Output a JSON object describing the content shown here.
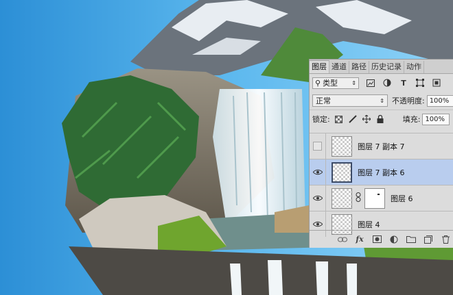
{
  "layers_panel": {
    "tabs": [
      {
        "label": "图层",
        "active": true
      },
      {
        "label": "通道",
        "active": false
      },
      {
        "label": "路径",
        "active": false
      },
      {
        "label": "历史记录",
        "active": false
      },
      {
        "label": "动作",
        "active": false
      }
    ],
    "filter": {
      "label": "类型"
    },
    "blend_mode": "正常",
    "opacity_label": "不透明度:",
    "opacity_value": "100%",
    "lock_label": "锁定:",
    "fill_label": "填充:",
    "fill_value": "100%",
    "layers": [
      {
        "name": "图层 7 副本 7",
        "visible": false,
        "selected": false,
        "has_mask": false
      },
      {
        "name": "图层 7 副本 6",
        "visible": true,
        "selected": true,
        "has_mask": false
      },
      {
        "name": "图层 6",
        "visible": true,
        "selected": false,
        "has_mask": true
      },
      {
        "name": "图层 4",
        "visible": true,
        "selected": false,
        "has_mask": false
      }
    ],
    "bottom_icons": [
      "link-icon",
      "fx-icon",
      "add-mask-icon",
      "adjustment-icon",
      "group-folder-icon",
      "new-layer-icon",
      "trash-icon"
    ]
  }
}
